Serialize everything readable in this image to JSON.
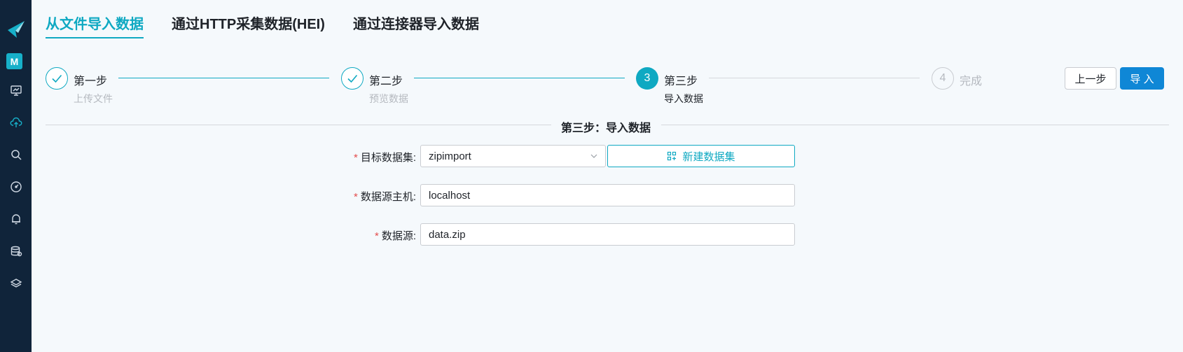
{
  "sidebar": {
    "avatar_letter": "M",
    "icons": [
      "logo-icon",
      "dashboard-icon",
      "cloud-upload-icon",
      "search-icon",
      "gauge-icon",
      "bell-icon",
      "database-icon",
      "layers-icon"
    ],
    "active_icon": "cloud-upload-icon",
    "bg_color": "#10243a",
    "accent_color": "#17b0c9"
  },
  "tabs": [
    {
      "label": "从文件导入数据",
      "active": true
    },
    {
      "label": "通过HTTP采集数据(HEI)",
      "active": false
    },
    {
      "label": "通过连接器导入数据",
      "active": false
    }
  ],
  "steps": [
    {
      "number": "1",
      "title": "第一步",
      "desc": "上传文件",
      "status": "done"
    },
    {
      "number": "2",
      "title": "第二步",
      "desc": "预览数据",
      "status": "done"
    },
    {
      "number": "3",
      "title": "第三步",
      "desc": "导入数据",
      "status": "current"
    },
    {
      "number": "4",
      "title": "完成",
      "desc": "",
      "status": "pending"
    }
  ],
  "actions": {
    "prev_label": "上一步",
    "import_label": "导 入"
  },
  "section_title": "第三步：导入数据",
  "form": {
    "dataset_label": "目标数据集:",
    "dataset_value": "zipimport",
    "new_dataset_label": "新建数据集",
    "host_label": "数据源主机:",
    "host_value": "localhost",
    "source_label": "数据源:",
    "source_value": "data.zip"
  },
  "colors": {
    "primary": "#0fa9c2",
    "button_blue": "#0f87d6",
    "required": "#e34d4d"
  }
}
